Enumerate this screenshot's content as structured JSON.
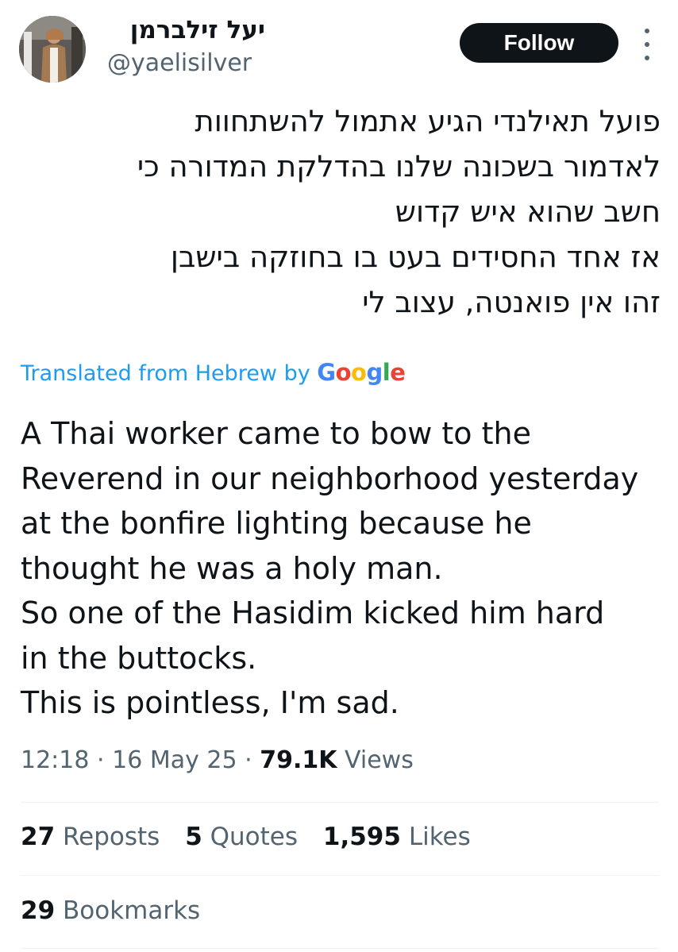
{
  "author": {
    "display_name": "יעל זילברמן",
    "handle": "@yaelisilver",
    "follow_label": "Follow"
  },
  "post": {
    "original_lines": [
      "פועל תאילנדי הגיע אתמול להשתחוות",
      "לאדמור בשכונה שלנו בהדלקת המדורה כי",
      "חשב שהוא איש קדוש",
      "אז אחד החסידים בעט בו בחוזקה בישבן",
      "זהו אין פואנטה, עצוב לי"
    ],
    "translated_label": "Translated from Hebrew by",
    "translator_brand": [
      "G",
      "o",
      "o",
      "g",
      "l",
      "e"
    ],
    "translation_lines": [
      "A Thai worker came to bow to the",
      "Reverend in our neighborhood yesterday",
      "at the bonfire lighting because he",
      "thought he was a holy man.",
      "So one of the Hasidim kicked him hard",
      "in the buttocks.",
      "This is pointless, I'm sad."
    ]
  },
  "meta": {
    "time": "12:18",
    "separator": "·",
    "date": "16 May 25",
    "views_count": "79.1K",
    "views_label": "Views"
  },
  "stats": {
    "reposts_count": "27",
    "reposts_label": "Reposts",
    "quotes_count": "5",
    "quotes_label": "Quotes",
    "likes_count": "1,595",
    "likes_label": "Likes",
    "bookmarks_count": "29",
    "bookmarks_label": "Bookmarks"
  },
  "icons": {
    "more": "more-vertical-icon"
  },
  "colors": {
    "link": "#1d9bf0",
    "muted": "#536471",
    "text": "#0f1419",
    "button": "#0f1419"
  }
}
